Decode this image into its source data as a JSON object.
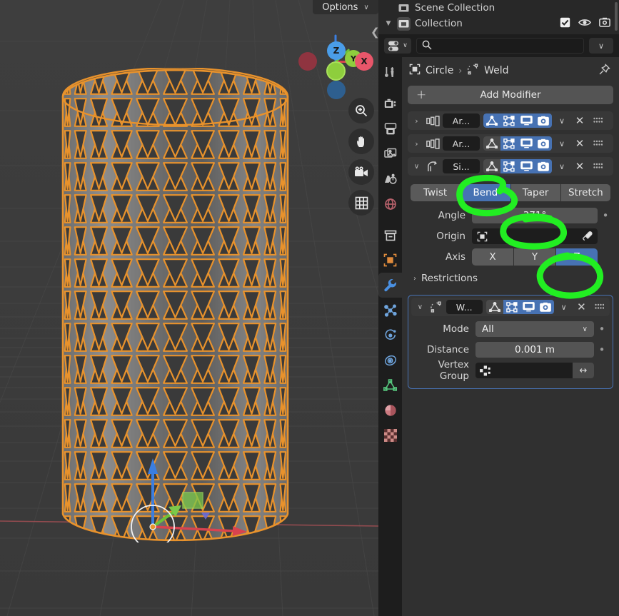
{
  "app": "Blender",
  "viewport": {
    "options_label": "Options",
    "options_chevron": "∨",
    "gizmo": {
      "z": "Z",
      "y": "Y",
      "x": "X"
    },
    "tools": [
      {
        "name": "zoom-view-icon",
        "label": "Zoom"
      },
      {
        "name": "pan-view-icon",
        "label": "Move"
      },
      {
        "name": "camera-view-icon",
        "label": "Camera"
      },
      {
        "name": "toggle-grid-icon",
        "label": "Grid"
      }
    ],
    "object": "lattice-cylinder"
  },
  "outliner": {
    "rows": [
      {
        "label": "Scene Collection",
        "icon": "scene-collection-icon",
        "expand": ""
      },
      {
        "label": "Collection",
        "icon": "collection-icon",
        "expand": "▼"
      }
    ],
    "toggles": [
      "checkbox-icon",
      "eye-icon",
      "camera-icon"
    ],
    "check": "✔"
  },
  "properties": {
    "search_placeholder": "",
    "filter_chevron": "∨",
    "header_chevron": "∨",
    "tabs": [
      {
        "name": "tool",
        "active": false
      },
      {
        "name": "render",
        "active": false
      },
      {
        "name": "output",
        "active": false
      },
      {
        "name": "view-layer",
        "active": false
      },
      {
        "name": "scene",
        "active": false
      },
      {
        "name": "world",
        "active": false
      },
      {
        "name": "collection",
        "active": false
      },
      {
        "name": "object",
        "active": false
      },
      {
        "name": "modifiers",
        "active": true
      },
      {
        "name": "particles",
        "active": false
      },
      {
        "name": "physics",
        "active": false
      },
      {
        "name": "constraints",
        "active": false
      },
      {
        "name": "object-data",
        "active": false
      },
      {
        "name": "material",
        "active": false
      },
      {
        "name": "texture",
        "active": false
      }
    ],
    "breadcrumb": {
      "object": "Circle",
      "separator": "›",
      "modifier": "Weld"
    },
    "add_modifier": "Add Modifier",
    "add_plus": "+",
    "modifiers": [
      {
        "name": "Ar...",
        "type": "array",
        "expanded": false,
        "expand_glyph": "›",
        "toggles": [
          true,
          true,
          true,
          true
        ],
        "dropdown": "∨",
        "close": "✕"
      },
      {
        "name": "Ar...",
        "type": "array",
        "expanded": false,
        "expand_glyph": "›",
        "toggles": [
          false,
          true,
          true,
          true
        ],
        "dropdown": "∨",
        "close": "✕"
      },
      {
        "name": "Si...",
        "type": "simple-deform",
        "expanded": true,
        "expand_glyph": "∨",
        "toggles": [
          false,
          true,
          true,
          true
        ],
        "dropdown": "∨",
        "close": "✕"
      }
    ],
    "simple_deform": {
      "modes": [
        "Twist",
        "Bend",
        "Taper",
        "Stretch"
      ],
      "selected_mode": "Bend",
      "angle_label": "Angle",
      "angle_value": "371°",
      "origin_label": "Origin",
      "origin_value": "",
      "axis_label": "Axis",
      "axes": [
        "X",
        "Y",
        "Z"
      ],
      "selected_axis": "Z",
      "restrictions_label": "Restrictions",
      "restrictions_glyph": "›",
      "animate_dot": "•"
    },
    "weld": {
      "name": "W...",
      "expand_glyph": "∨",
      "toggles": [
        false,
        true,
        true,
        true
      ],
      "dropdown": "∨",
      "close": "✕",
      "mode_label": "Mode",
      "mode_value": "All",
      "mode_chevron": "∨",
      "distance_label": "Distance",
      "distance_value": "0.001 m",
      "vertex_group_label": "Vertex Group",
      "vertex_group_value": "",
      "animate_dot": "•",
      "swap_glyph": "↔"
    }
  },
  "annotations": {
    "color": "#22ee22",
    "marks": [
      "bend-circle",
      "angle-circle",
      "z-axis-circle"
    ]
  },
  "colors": {
    "accent_blue": "#4772b3",
    "selected_orange": "#e8922c",
    "panel_bg": "#303030",
    "editor_bg": "#1d1d1d",
    "viewport_bg": "#3b3b3b",
    "annotation_green": "#22ee22"
  }
}
